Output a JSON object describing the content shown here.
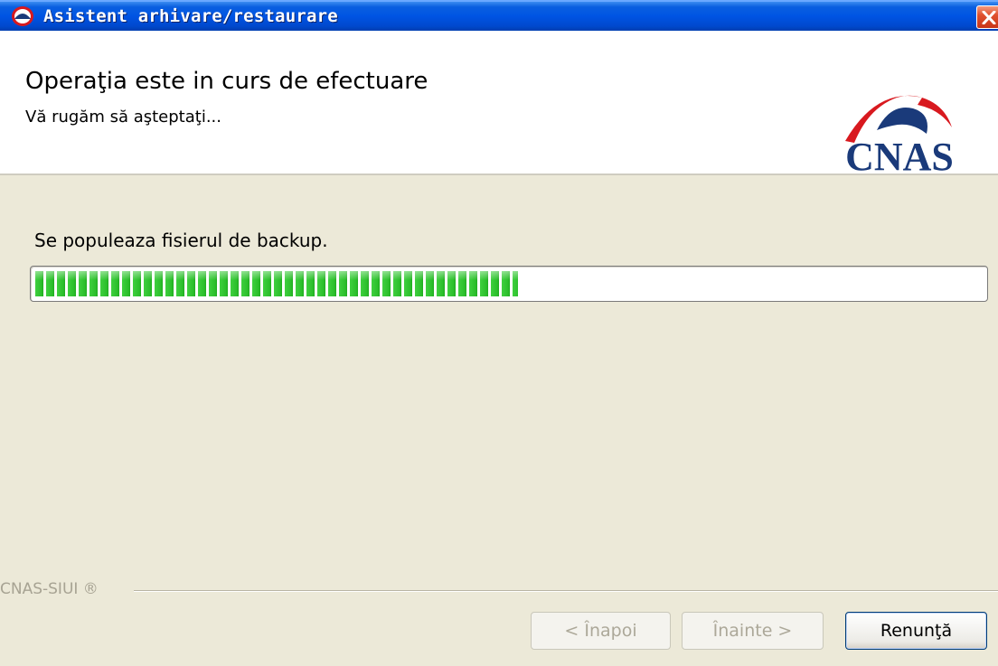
{
  "window": {
    "title": "Asistent arhivare/restaurare",
    "accent_color": "#0054e3"
  },
  "header": {
    "title": "Operaţia este in curs de efectuare",
    "subtitle": "Vă rugăm să aşteptaţi...",
    "logo_text": "CNAS",
    "logo_colors": {
      "text": "#1a3a7a",
      "arc": "#d8191f"
    }
  },
  "progress": {
    "status_text": "Se populeaza fisierul de backup.",
    "percent": 51,
    "color": "#2bbf2b"
  },
  "footer": {
    "brand": "CNAS-SIUI ®"
  },
  "buttons": {
    "back": "< Înapoi",
    "next": "Înainte >",
    "cancel": "Renunţă"
  }
}
